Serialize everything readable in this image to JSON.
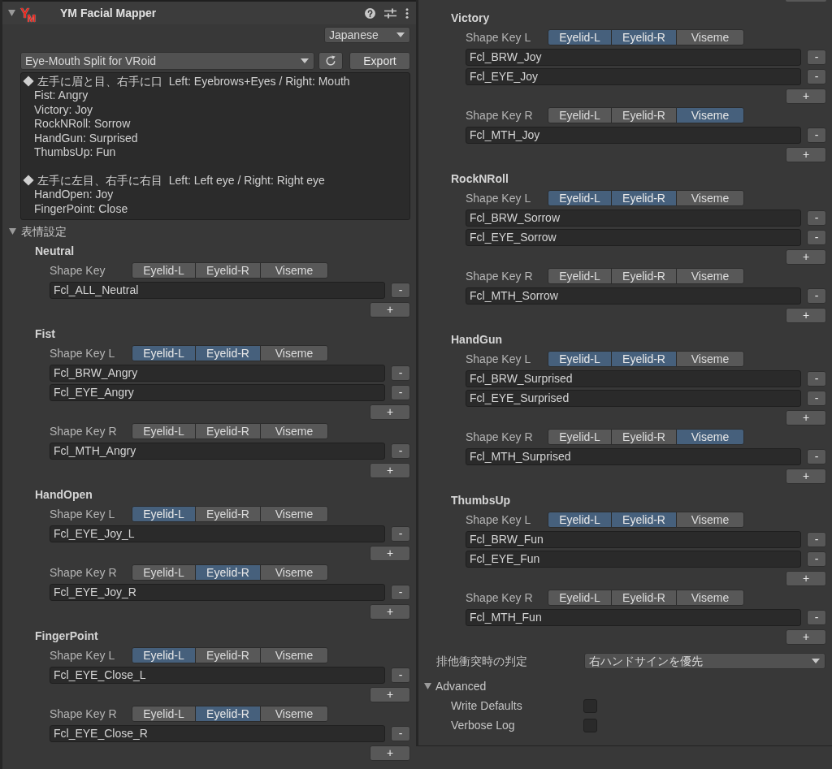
{
  "left_panel": {
    "header": {
      "expanded": true,
      "logo": "Y$_{M}$",
      "title": "YM Facial Mapper"
    },
    "language": {
      "value": "Japanese"
    },
    "preset": {
      "value": "Eye-Mouth Split for VRoid",
      "export_label": "Export"
    },
    "description": {
      "groups": [
        {
          "heading": "◆ 左手に眉と目、右手に口  Left: Eyebrows+Eyes / Right: Mouth",
          "lines": [
            "Fist: Angry",
            "Victory: Joy",
            "RockNRoll: Sorrow",
            "HandGun: Surprised",
            "ThumbsUp: Fun"
          ]
        },
        {
          "heading": "◆ 左手に左目、右手に右目  Left: Left eye / Right: Right eye",
          "lines": [
            "HandOpen: Joy",
            "FingerPoint: Close"
          ]
        }
      ]
    },
    "expressions_foldout": {
      "label": "表情設定",
      "expanded": true
    },
    "expressions": [
      {
        "name": "Neutral",
        "slots": [
          {
            "label": "Shape Key",
            "toggles": [
              {
                "label": "Eyelid-L",
                "selected": false
              },
              {
                "label": "Eyelid-R",
                "selected": false
              },
              {
                "label": "Viseme",
                "selected": false
              }
            ],
            "keys": [
              {
                "value": "Fcl_ALL_Neutral",
                "remove_label": "-"
              }
            ],
            "add_label": "+"
          }
        ]
      },
      {
        "name": "Fist",
        "slots": [
          {
            "label": "Shape Key L",
            "toggles": [
              {
                "label": "Eyelid-L",
                "selected": true
              },
              {
                "label": "Eyelid-R",
                "selected": true
              },
              {
                "label": "Viseme",
                "selected": false
              }
            ],
            "keys": [
              {
                "value": "Fcl_BRW_Angry",
                "remove_label": "-"
              },
              {
                "value": "Fcl_EYE_Angry",
                "remove_label": "-"
              }
            ],
            "add_label": "+"
          },
          {
            "label": "Shape Key R",
            "toggles": [
              {
                "label": "Eyelid-L",
                "selected": false
              },
              {
                "label": "Eyelid-R",
                "selected": false
              },
              {
                "label": "Viseme",
                "selected": false
              }
            ],
            "keys": [
              {
                "value": "Fcl_MTH_Angry",
                "remove_label": "-"
              }
            ],
            "add_label": "+"
          }
        ]
      },
      {
        "name": "HandOpen",
        "slots": [
          {
            "label": "Shape Key L",
            "toggles": [
              {
                "label": "Eyelid-L",
                "selected": true
              },
              {
                "label": "Eyelid-R",
                "selected": false
              },
              {
                "label": "Viseme",
                "selected": false
              }
            ],
            "keys": [
              {
                "value": "Fcl_EYE_Joy_L",
                "remove_label": "-"
              }
            ],
            "add_label": "+"
          },
          {
            "label": "Shape Key R",
            "toggles": [
              {
                "label": "Eyelid-L",
                "selected": false
              },
              {
                "label": "Eyelid-R",
                "selected": true
              },
              {
                "label": "Viseme",
                "selected": false
              }
            ],
            "keys": [
              {
                "value": "Fcl_EYE_Joy_R",
                "remove_label": "-"
              }
            ],
            "add_label": "+"
          }
        ]
      },
      {
        "name": "FingerPoint",
        "slots": [
          {
            "label": "Shape Key L",
            "toggles": [
              {
                "label": "Eyelid-L",
                "selected": true
              },
              {
                "label": "Eyelid-R",
                "selected": false
              },
              {
                "label": "Viseme",
                "selected": false
              }
            ],
            "keys": [
              {
                "value": "Fcl_EYE_Close_L",
                "remove_label": "-"
              }
            ],
            "add_label": "+"
          },
          {
            "label": "Shape Key R",
            "toggles": [
              {
                "label": "Eyelid-L",
                "selected": false
              },
              {
                "label": "Eyelid-R",
                "selected": true
              },
              {
                "label": "Viseme",
                "selected": false
              }
            ],
            "keys": [
              {
                "value": "Fcl_EYE_Close_R",
                "remove_label": "-"
              }
            ],
            "add_label": "+"
          }
        ]
      }
    ]
  },
  "right_panel": {
    "expressions": [
      {
        "name": "Victory",
        "slots": [
          {
            "label": "Shape Key L",
            "toggles": [
              {
                "label": "Eyelid-L",
                "selected": true
              },
              {
                "label": "Eyelid-R",
                "selected": true
              },
              {
                "label": "Viseme",
                "selected": false
              }
            ],
            "keys": [
              {
                "value": "Fcl_BRW_Joy",
                "remove_label": "-"
              },
              {
                "value": "Fcl_EYE_Joy",
                "remove_label": "-"
              }
            ],
            "add_label": "+"
          },
          {
            "label": "Shape Key R",
            "toggles": [
              {
                "label": "Eyelid-L",
                "selected": false
              },
              {
                "label": "Eyelid-R",
                "selected": false
              },
              {
                "label": "Viseme",
                "selected": true
              }
            ],
            "keys": [
              {
                "value": "Fcl_MTH_Joy",
                "remove_label": "-"
              }
            ],
            "add_label": "+"
          }
        ]
      },
      {
        "name": "RockNRoll",
        "slots": [
          {
            "label": "Shape Key L",
            "toggles": [
              {
                "label": "Eyelid-L",
                "selected": true
              },
              {
                "label": "Eyelid-R",
                "selected": true
              },
              {
                "label": "Viseme",
                "selected": false
              }
            ],
            "keys": [
              {
                "value": "Fcl_BRW_Sorrow",
                "remove_label": "-"
              },
              {
                "value": "Fcl_EYE_Sorrow",
                "remove_label": "-"
              }
            ],
            "add_label": "+"
          },
          {
            "label": "Shape Key R",
            "toggles": [
              {
                "label": "Eyelid-L",
                "selected": false
              },
              {
                "label": "Eyelid-R",
                "selected": false
              },
              {
                "label": "Viseme",
                "selected": false
              }
            ],
            "keys": [
              {
                "value": "Fcl_MTH_Sorrow",
                "remove_label": "-"
              }
            ],
            "add_label": "+"
          }
        ]
      },
      {
        "name": "HandGun",
        "slots": [
          {
            "label": "Shape Key L",
            "toggles": [
              {
                "label": "Eyelid-L",
                "selected": true
              },
              {
                "label": "Eyelid-R",
                "selected": true
              },
              {
                "label": "Viseme",
                "selected": false
              }
            ],
            "keys": [
              {
                "value": "Fcl_BRW_Surprised",
                "remove_label": "-"
              },
              {
                "value": "Fcl_EYE_Surprised",
                "remove_label": "-"
              }
            ],
            "add_label": "+"
          },
          {
            "label": "Shape Key R",
            "toggles": [
              {
                "label": "Eyelid-L",
                "selected": false
              },
              {
                "label": "Eyelid-R",
                "selected": false
              },
              {
                "label": "Viseme",
                "selected": true
              }
            ],
            "keys": [
              {
                "value": "Fcl_MTH_Surprised",
                "remove_label": "-"
              }
            ],
            "add_label": "+"
          }
        ]
      },
      {
        "name": "ThumbsUp",
        "slots": [
          {
            "label": "Shape Key L",
            "toggles": [
              {
                "label": "Eyelid-L",
                "selected": true
              },
              {
                "label": "Eyelid-R",
                "selected": true
              },
              {
                "label": "Viseme",
                "selected": false
              }
            ],
            "keys": [
              {
                "value": "Fcl_BRW_Fun",
                "remove_label": "-"
              },
              {
                "value": "Fcl_EYE_Fun",
                "remove_label": "-"
              }
            ],
            "add_label": "+"
          },
          {
            "label": "Shape Key R",
            "toggles": [
              {
                "label": "Eyelid-L",
                "selected": false
              },
              {
                "label": "Eyelid-R",
                "selected": false
              },
              {
                "label": "Viseme",
                "selected": false
              }
            ],
            "keys": [
              {
                "value": "Fcl_MTH_Fun",
                "remove_label": "-"
              }
            ],
            "add_label": "+"
          }
        ]
      }
    ],
    "conflict_rule": {
      "label": "排他衝突時の判定",
      "value": "右ハンドサインを優先"
    },
    "advanced": {
      "label": "Advanced",
      "expanded": true,
      "options": [
        {
          "label": "Write Defaults",
          "checked": false
        },
        {
          "label": "Verbose Log",
          "checked": false
        }
      ]
    }
  }
}
